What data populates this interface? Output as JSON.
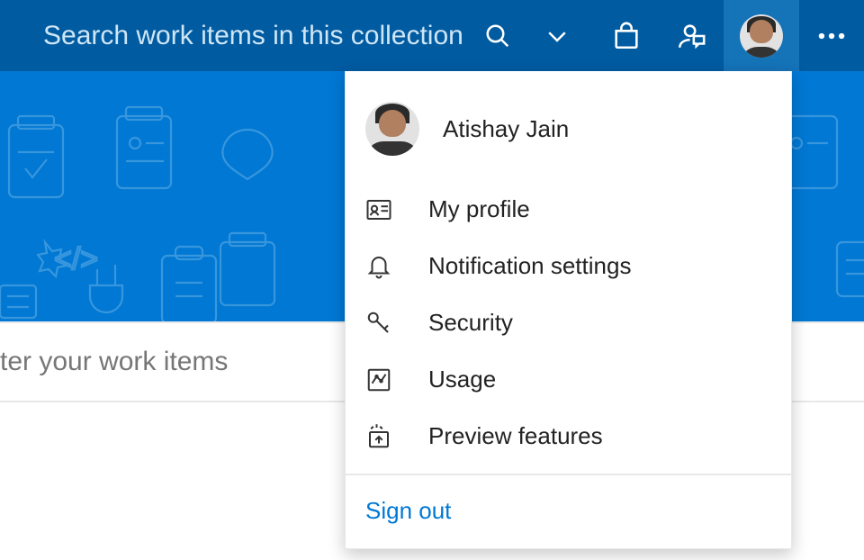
{
  "search": {
    "placeholder": "Search work items in this collection"
  },
  "filter": {
    "placeholder": "ter your work items"
  },
  "user": {
    "name": "Atishay Jain"
  },
  "menu": {
    "items": [
      {
        "icon": "profile-card-icon",
        "label": "My profile"
      },
      {
        "icon": "bell-icon",
        "label": "Notification settings"
      },
      {
        "icon": "key-icon",
        "label": "Security"
      },
      {
        "icon": "chart-icon",
        "label": "Usage"
      },
      {
        "icon": "preview-icon",
        "label": "Preview features"
      }
    ],
    "signout": "Sign out"
  }
}
